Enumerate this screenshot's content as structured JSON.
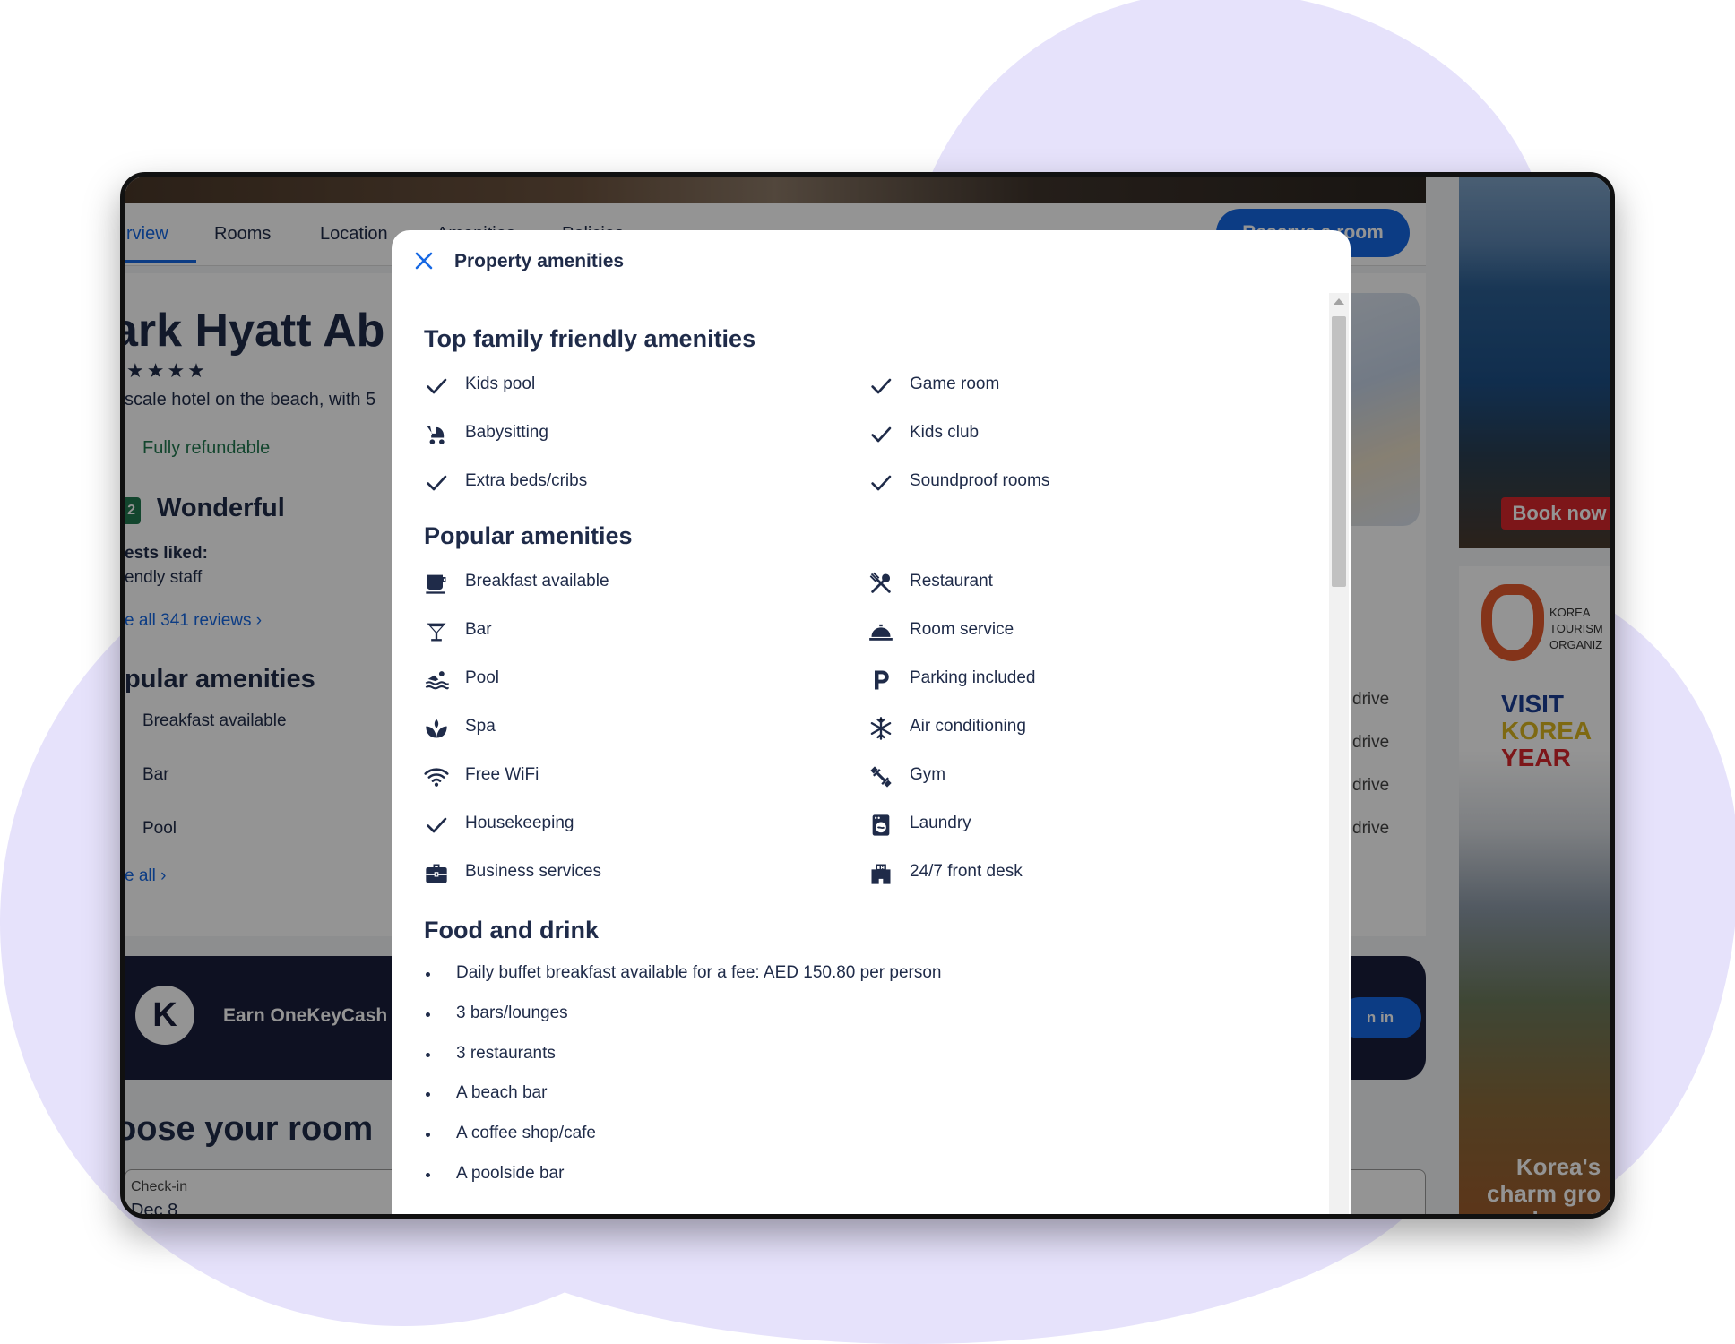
{
  "background_page": {
    "nav_tabs": [
      "rview",
      "Rooms",
      "Location",
      "Amenities",
      "Policies"
    ],
    "reserve_button": "Reserve a room",
    "hotel_name": "ark Hyatt Ab",
    "stars": "★★★★",
    "tagline": "scale hotel on the beach, with 5",
    "refund": "Fully refundable",
    "score": "2",
    "score_word": "Wonderful",
    "guests_liked": "ests liked:",
    "staff": "endly staff",
    "reviews_link": "e all 341 reviews  ›",
    "popular_title": "pular amenities",
    "amenities": [
      "Breakfast available",
      "Bar",
      "Pool"
    ],
    "see_all": "e all  ›",
    "drive_labels": [
      "drive",
      "drive",
      "drive",
      "drive"
    ],
    "onekey_text": "Earn OneKeyCash",
    "signin": "n in",
    "choose_room": "oose your room",
    "checkin_label": "Check-in",
    "checkin_value": "Dec 8"
  },
  "ads": {
    "book_now": "Book now",
    "korea_org": [
      "KOREA",
      "TOURISM",
      "ORGANIZ"
    ],
    "visit": "VISIT",
    "korea": "KOREA",
    "year": "YEAR",
    "bottom_text": [
      "Korea's",
      "charm gro",
      "deeper"
    ]
  },
  "modal": {
    "title": "Property amenities",
    "sections": {
      "family": {
        "title": "Top family friendly amenities",
        "left": [
          {
            "label": "Kids pool",
            "icon": "check-icon"
          },
          {
            "label": "Babysitting",
            "icon": "stroller-icon"
          },
          {
            "label": "Extra beds/cribs",
            "icon": "check-icon"
          }
        ],
        "right": [
          {
            "label": "Game room",
            "icon": "check-icon"
          },
          {
            "label": "Kids club",
            "icon": "check-icon"
          },
          {
            "label": "Soundproof rooms",
            "icon": "check-icon"
          }
        ]
      },
      "popular": {
        "title": "Popular amenities",
        "left": [
          {
            "label": "Breakfast available",
            "icon": "coffee-cup-icon"
          },
          {
            "label": "Bar",
            "icon": "cocktail-glass-icon"
          },
          {
            "label": "Pool",
            "icon": "swimmer-icon"
          },
          {
            "label": "Spa",
            "icon": "spa-lotus-icon"
          },
          {
            "label": "Free WiFi",
            "icon": "wifi-icon"
          },
          {
            "label": "Housekeeping",
            "icon": "check-icon"
          },
          {
            "label": "Business services",
            "icon": "briefcase-icon"
          }
        ],
        "right": [
          {
            "label": "Restaurant",
            "icon": "fork-knife-icon"
          },
          {
            "label": "Room service",
            "icon": "service-bell-icon"
          },
          {
            "label": "Parking included",
            "icon": "parking-icon"
          },
          {
            "label": "Air conditioning",
            "icon": "snowflake-icon"
          },
          {
            "label": "Gym",
            "icon": "dumbbell-icon"
          },
          {
            "label": "Laundry",
            "icon": "washing-machine-icon"
          },
          {
            "label": "24/7 front desk",
            "icon": "front-desk-24-icon"
          }
        ]
      },
      "food": {
        "title": "Food and drink",
        "items": [
          "Daily buffet breakfast available for a fee: AED 150.80 per person",
          "3 bars/lounges",
          "3 restaurants",
          "A beach bar",
          "A coffee shop/cafe",
          "A poolside bar"
        ]
      }
    }
  },
  "colors": {
    "accent_blue": "#1668e3",
    "text_navy": "#1f2b49",
    "green": "#227950",
    "overlay": "rgba(0,0,0,0.42)",
    "backdrop_blob": "#e6e2fb"
  }
}
